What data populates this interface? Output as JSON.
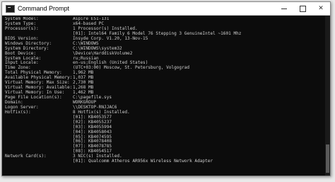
{
  "window": {
    "title": "Command Prompt",
    "minimize_icon": "minimize-icon",
    "maximize_icon": "maximize-icon",
    "close_symbol": "✕"
  },
  "colors": {
    "console_bg": "#0c0c0c",
    "console_text": "#cccccc",
    "titlebar_bg": "#ffffff"
  },
  "lines": [
    {
      "k": "System Model:",
      "v": "Aspire E51-131"
    },
    {
      "k": "System Type:",
      "v": "x64-based PC"
    },
    {
      "k": "Processor(s):",
      "v": "1 Processor(s) Installed."
    },
    {
      "k": "",
      "v": "[01]: Intel64 Family 6 Model 76 Stepping 3 GenuineIntel ~1601 Mhz"
    },
    {
      "k": "BIOS Version:",
      "v": "Insyde Corp. V1.20, 13-Nov-15"
    },
    {
      "k": "Windows Directory:",
      "v": "C:\\WINDOWS"
    },
    {
      "k": "System Directory:",
      "v": "C:\\WINDOWS\\system32"
    },
    {
      "k": "Boot Device:",
      "v": "\\Device\\HarddiskVolume2"
    },
    {
      "k": "System Locale:",
      "v": "ru;Russian"
    },
    {
      "k": "Input Locale:",
      "v": "en-us;English (United States)"
    },
    {
      "k": "Time Zone:",
      "v": "(UTC+03:00) Moscow, St. Petersburg, Volgograd"
    },
    {
      "k": "Total Physical Memory:",
      "v": "1,962 MB"
    },
    {
      "k": "Available Physical Memory:",
      "v": "1,037 MB"
    },
    {
      "k": "Virtual Memory: Max Size:",
      "v": "2,730 MB"
    },
    {
      "k": "Virtual Memory: Available:",
      "v": "1,268 MB"
    },
    {
      "k": "Virtual Memory: In Use:",
      "v": "1,462 MB"
    },
    {
      "k": "Page File Location(s):",
      "v": "C:\\pagefile.sys"
    },
    {
      "k": "Domain:",
      "v": "WORKGROUP"
    },
    {
      "k": "Logon Server:",
      "v": "\\\\DESKTOP-RNJJAC6"
    },
    {
      "k": "Hotfix(s):",
      "v": "8 Hotfix(s) Installed."
    },
    {
      "k": "",
      "v": "[01]: KB4053577"
    },
    {
      "k": "",
      "v": "[02]: KB4055237"
    },
    {
      "k": "",
      "v": "[03]: KB4055994"
    },
    {
      "k": "",
      "v": "[04]: KB4058043"
    },
    {
      "k": "",
      "v": "[05]: KB4074595"
    },
    {
      "k": "",
      "v": "[06]: KB4078408"
    },
    {
      "k": "",
      "v": "[07]: KB4078785"
    },
    {
      "k": "",
      "v": "[08]: KB4054517"
    },
    {
      "k": "Network Card(s):",
      "v": "3 NIC(s) Installed."
    },
    {
      "k": "",
      "v": "[01]: Qualcomm Atheros AR956x Wireless Network Adapter"
    }
  ]
}
